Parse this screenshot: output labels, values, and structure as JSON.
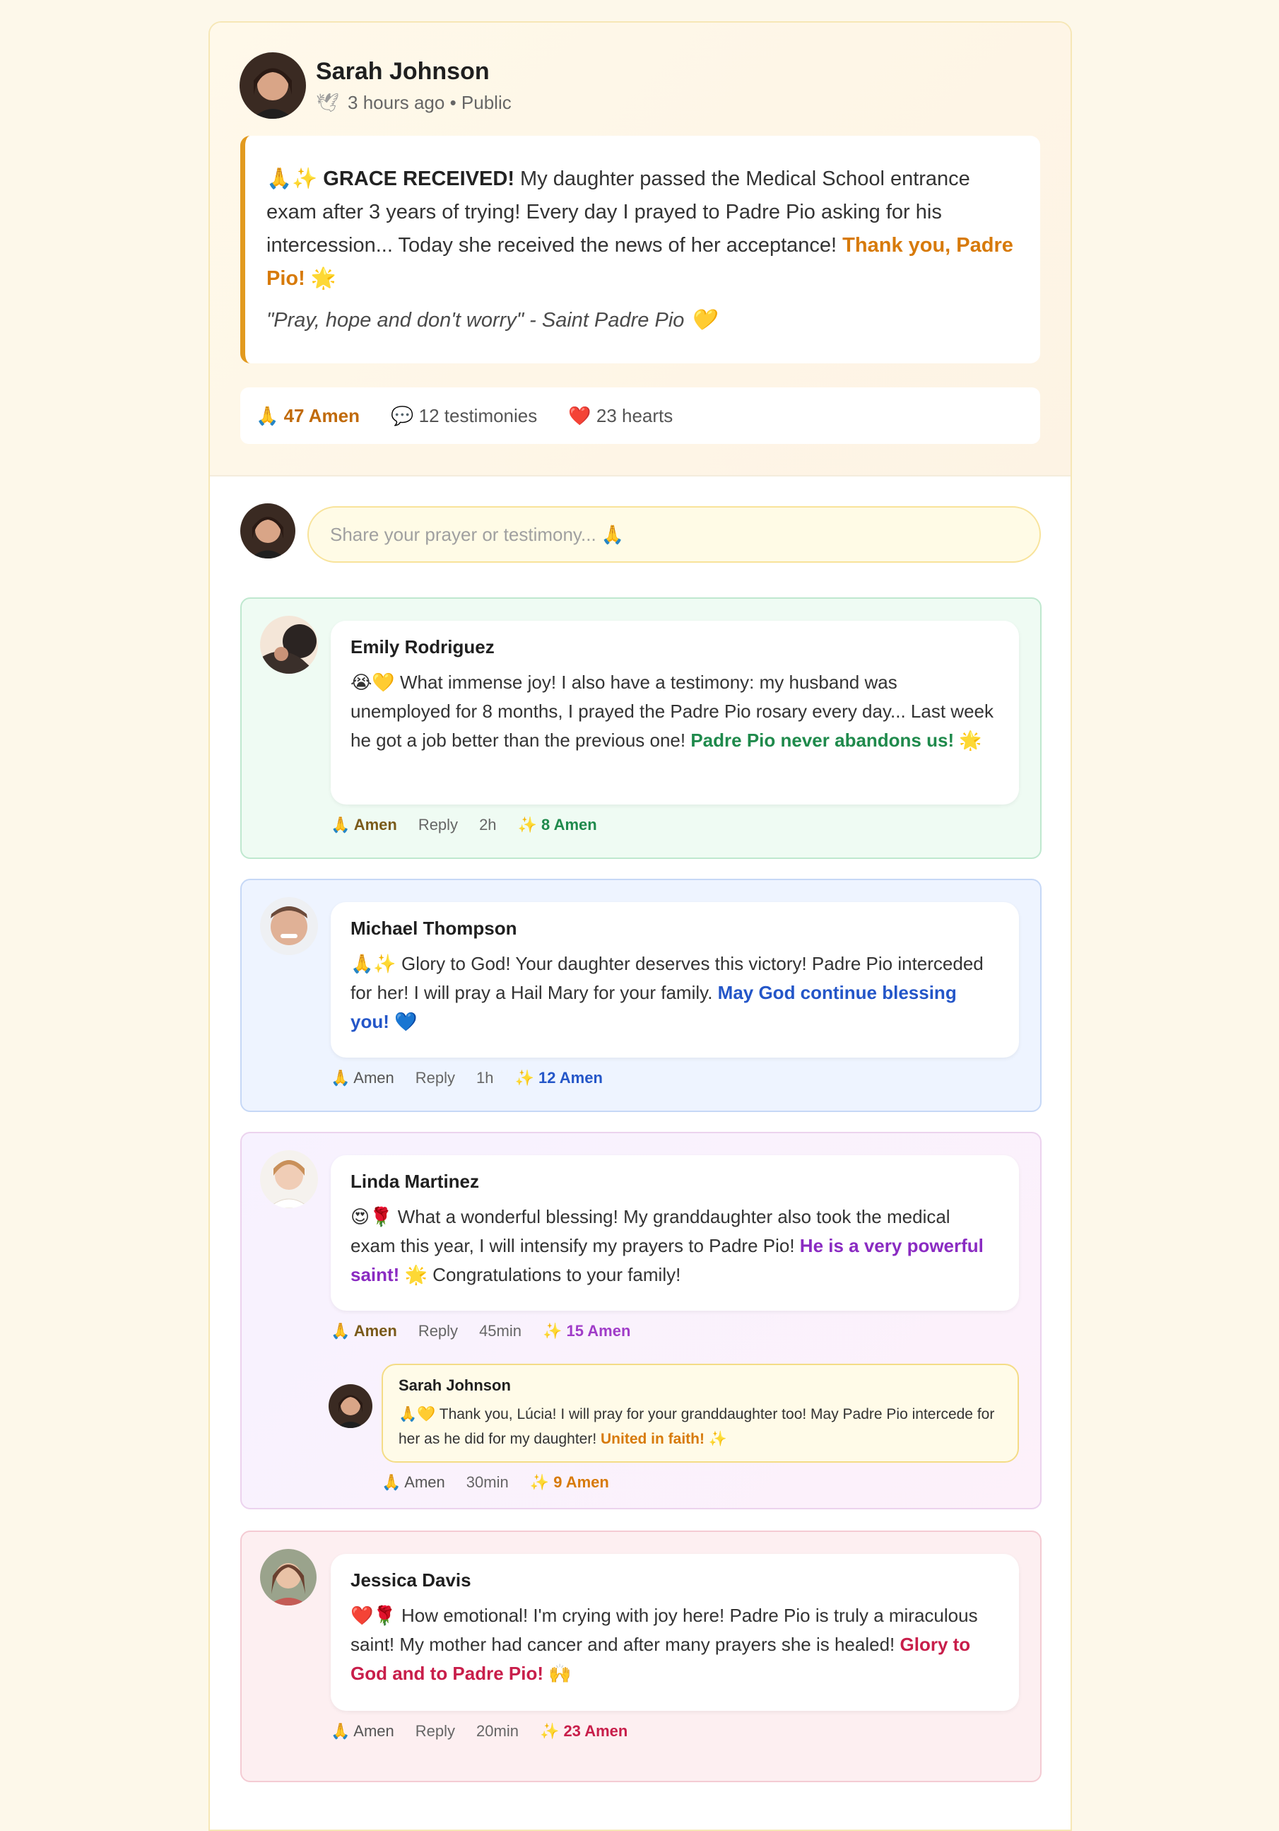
{
  "post": {
    "author": "Sarah Johnson",
    "time": "3 hours ago",
    "visibility": "Public",
    "meta_sep": " • ",
    "dove_glyph": "🕊",
    "emoji_prefix": "🙏✨",
    "headline": "GRACE RECEIVED!",
    "body": " My daughter passed the Medical School entrance exam after 3 years of trying! Every day I prayed to Padre Pio asking for his intercession... Today she received the news of her acceptance! ",
    "highlight": "Thank you, Padre Pio! 🌟",
    "quote": "\"Pray, hope and don't worry\" - Saint Padre Pio 💛"
  },
  "stats": {
    "amen": "🙏 47 Amen",
    "testimonies": "💬 12 testimonies",
    "hearts": "❤️ 23 hearts"
  },
  "composer": {
    "placeholder": "Share your prayer or testimony... 🙏"
  },
  "comments": [
    {
      "name": "Emily Rodriguez",
      "text": "😭💛 What immense joy! I also have a testimony: my husband was unemployed for 8 months, I prayed the Padre Pio rosary every day... Last week he got a job better than the previous one! ",
      "highlight": "Padre Pio never abandons us! 🌟",
      "after": "",
      "amen": "🙏 Amen",
      "reply": "Reply",
      "time": "2h",
      "count": "✨ 8 Amen"
    },
    {
      "name": "Michael Thompson",
      "text": "🙏✨ Glory to God! Your daughter deserves this victory! Padre Pio interceded for her! I will pray a Hail Mary for your family. ",
      "highlight": "May God continue blessing you! 💙",
      "after": "",
      "amen": "🙏 Amen",
      "reply": "Reply",
      "time": "1h",
      "count": "✨ 12 Amen"
    },
    {
      "name": "Linda Martinez",
      "text": "😍🌹 What a wonderful blessing! My granddaughter also took the medical exam this year, I will intensify my prayers to Padre Pio! ",
      "highlight": "He is a very powerful saint!",
      "after": " 🌟 Congratulations to your family!",
      "amen": "🙏 Amen",
      "reply": "Reply",
      "time": "45min",
      "count": "✨ 15 Amen"
    },
    {
      "name": "Jessica Davis",
      "text": "❤️🌹 How emotional! I'm crying with joy here! Padre Pio is truly a miraculous saint! My mother had cancer and after many prayers she is healed! ",
      "highlight": "Glory to God and to Padre Pio!",
      "after": " 🙌",
      "amen": "🙏 Amen",
      "reply": "Reply",
      "time": "20min",
      "count": "✨ 23 Amen"
    }
  ],
  "reply": {
    "name": "Sarah Johnson",
    "text": "🙏💛 Thank you, Lúcia! I will pray for your granddaughter too! May Padre Pio intercede for her as he did for my daughter! ",
    "highlight": "United in faith!",
    "after": " ✨",
    "amen": "🙏 Amen",
    "time": "30min",
    "count": "✨ 9 Amen"
  }
}
